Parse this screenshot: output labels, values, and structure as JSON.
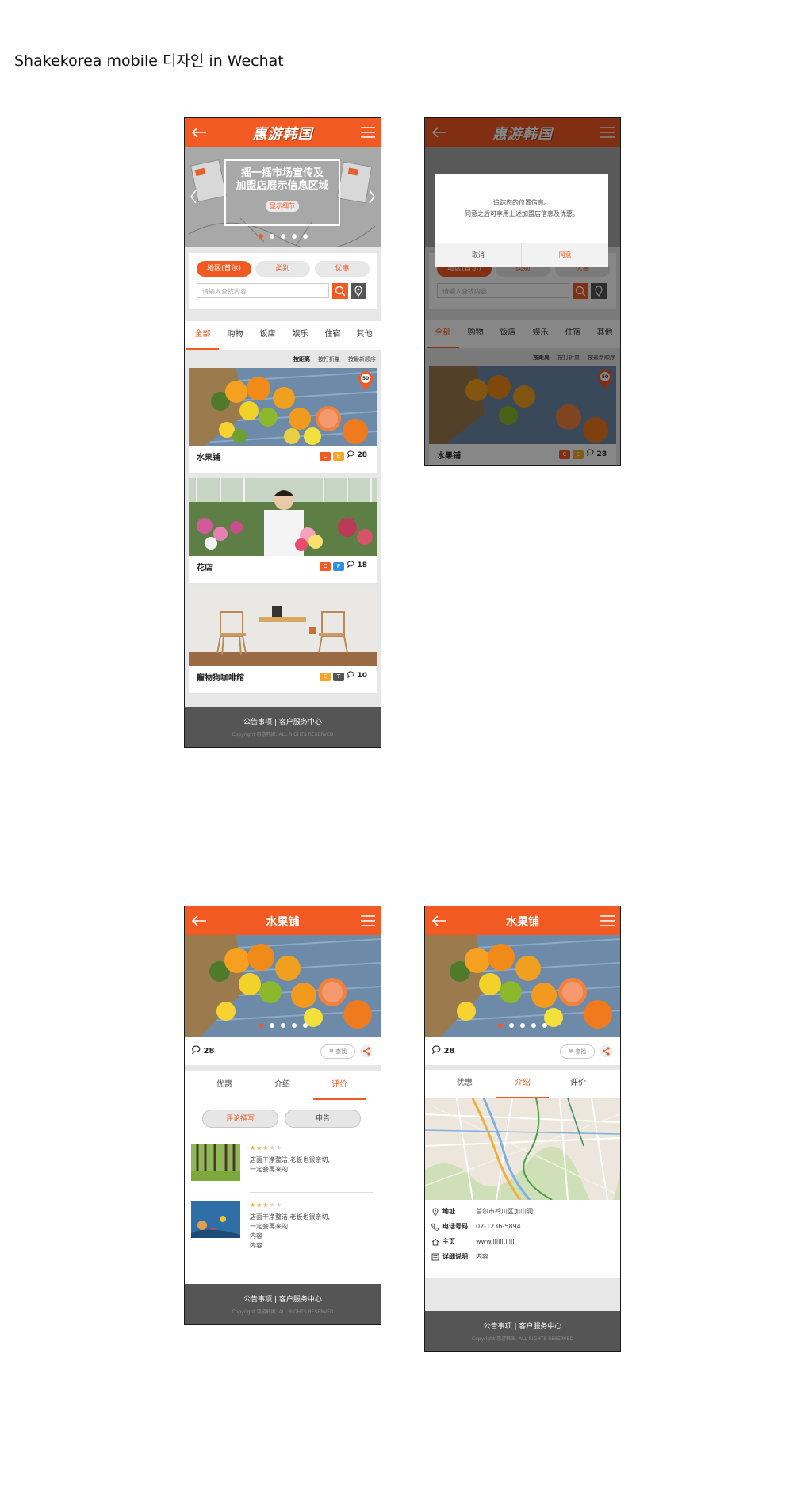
{
  "page_title": "Shakekorea mobile 디자인 in Wechat",
  "colors": {
    "accent": "#f25a23",
    "footer": "#555555",
    "dark_button": "#555555"
  },
  "logo_text": "惠游韩国",
  "home": {
    "banner": {
      "line1": "摇一摇市场宣传及",
      "line2": "加盟店展示信息区域",
      "button": "显示细节"
    },
    "filters": [
      "地区(首尔)",
      "类别",
      "优惠"
    ],
    "search_placeholder": "请输入查找内容",
    "tabs": [
      "全部",
      "购物",
      "饭店",
      "娱乐",
      "住宿",
      "其他"
    ],
    "sort": [
      "按距离",
      "按打折量",
      "按最新顺序"
    ],
    "distance_badge": "50",
    "cards": [
      {
        "name": "水果铺",
        "badges": [
          "C",
          "E"
        ],
        "comments": "28"
      },
      {
        "name": "花店",
        "badges": [
          "C",
          "P"
        ],
        "comments": "18"
      },
      {
        "name": "寵物狗咖啡館",
        "badges": [
          "E",
          "T"
        ],
        "comments": "10"
      }
    ]
  },
  "dialog": {
    "line1": "追踪您的位置信息。",
    "line2": "同意之后可享用上述加盟店信息及优惠。",
    "cancel": "取消",
    "agree": "同意",
    "card_name": "水果铺",
    "card_comments": "28"
  },
  "footer": {
    "notice": "公告事项",
    "support": "客户服务中心",
    "copyright": "Copyright 惠游韩国. ALL RIGHTS RESERVED"
  },
  "detail": {
    "title": "水果铺",
    "comments": "28",
    "like": "查找",
    "tabs": [
      "优惠",
      "介绍",
      "评价"
    ],
    "review_buttons": {
      "write": "评论撰写",
      "report": "申告"
    },
    "reviews": [
      {
        "text": "店面干净整洁,老板也很亲切,\n一定会再来的!",
        "rating": 3
      },
      {
        "text": "店面干净整洁,老板也很亲切,\n一定会再来的!\n内容\n内容",
        "rating": 3
      }
    ],
    "info": [
      {
        "icon": "location-icon",
        "label": "地址",
        "value": "首尔市衿川区加山洞"
      },
      {
        "icon": "phone-icon",
        "label": "电话号码",
        "value": "02-1236-5894"
      },
      {
        "icon": "home-icon",
        "label": "主页",
        "value": "www.llllll.llllll"
      },
      {
        "icon": "document-icon",
        "label": "详细说明",
        "value": "内容"
      }
    ]
  }
}
